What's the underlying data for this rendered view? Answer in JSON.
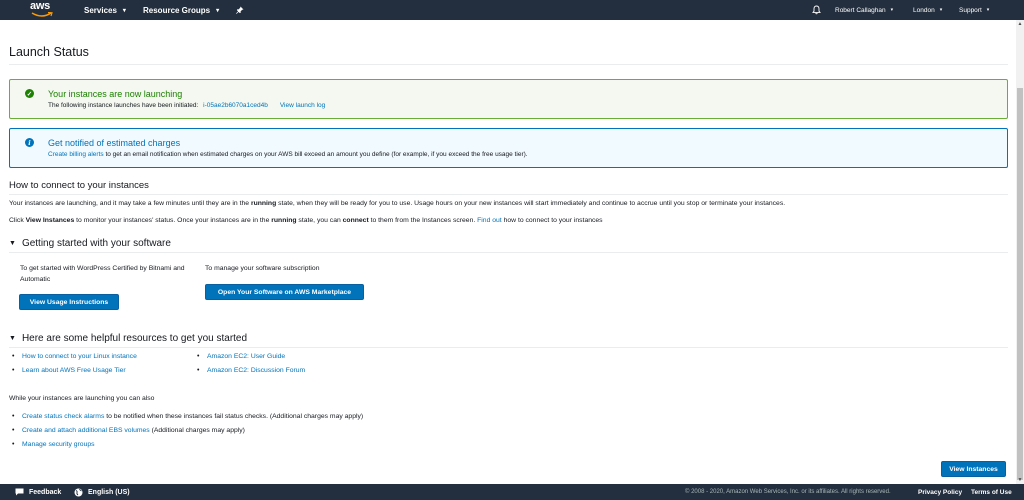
{
  "topnav": {
    "logo_text": "aws",
    "services": "Services",
    "resource_groups": "Resource Groups",
    "user": "Robert Callaghan",
    "region": "London",
    "support": "Support"
  },
  "page": {
    "title": "Launch Status"
  },
  "success_alert": {
    "title": "Your instances are now launching",
    "body": "The following instance launches have been initiated:",
    "instance_id": "i-05ae2b6070a1ced4b",
    "view_log": "View launch log"
  },
  "info_alert": {
    "title": "Get notified of estimated charges",
    "link": "Create billing alerts",
    "body": "to get an email notification when estimated charges on your AWS bill exceed an amount you define (for example, if you exceed the free usage tier)."
  },
  "connect": {
    "heading": "How to connect to your instances",
    "p1_a": "Your instances are launching, and it may take a few minutes until they are in the ",
    "p1_b": "running",
    "p1_c": " state, when they will be ready for you to use. Usage hours on your new instances will start immediately and continue to accrue until you stop or terminate your instances.",
    "p2_a": "Click ",
    "p2_b": "View Instances",
    "p2_c": " to monitor your instances' status. Once your instances are in the ",
    "p2_d": "running",
    "p2_e": " state, you can ",
    "p2_f": "connect",
    "p2_g": " to them from the Instances screen. ",
    "p2_link": "Find out",
    "p2_h": " how to connect to your instances"
  },
  "getting_started": {
    "heading": "Getting started with your software",
    "left_text": "To get started with WordPress Certified by Bitnami and Automatic",
    "left_button": "View Usage Instructions",
    "right_text": "To manage your software subscription",
    "right_button": "Open Your Software on AWS Marketplace"
  },
  "resources": {
    "heading": "Here are some helpful resources to get you started",
    "left_links": [
      "How to connect to your Linux instance",
      "Learn about AWS Free Usage Tier"
    ],
    "right_links": [
      "Amazon EC2: User Guide",
      "Amazon EC2: Discussion Forum"
    ]
  },
  "also": {
    "heading": "While your instances are launching you can also",
    "items": [
      {
        "link": "Create status check alarms",
        "text": " to be notified when these instances fail status checks. (Additional charges may apply)"
      },
      {
        "link": "Create and attach additional EBS volumes",
        "text": " (Additional charges may apply)"
      },
      {
        "link": "Manage security groups",
        "text": ""
      }
    ]
  },
  "view_instances_button": "View Instances",
  "footer": {
    "feedback": "Feedback",
    "language": "English (US)",
    "copyright": "© 2008 - 2020, Amazon Web Services, Inc. or its affiliates. All rights reserved.",
    "privacy": "Privacy Policy",
    "terms": "Terms of Use"
  },
  "colors": {
    "nav_bg": "#232f3e",
    "link": "#0073bb",
    "success": "#1d8102",
    "button": "#0073bb"
  },
  "icons": [
    "bell-icon",
    "pin-icon",
    "success-check-icon",
    "info-icon",
    "feedback-icon",
    "globe-icon"
  ]
}
